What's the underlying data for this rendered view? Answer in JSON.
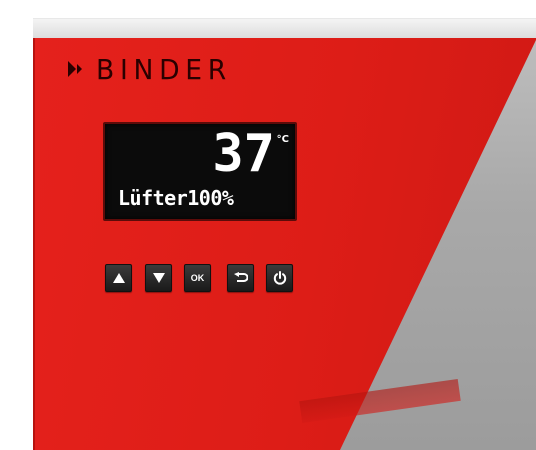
{
  "device": {
    "brand": "BINDER",
    "display": {
      "temperature": "37",
      "unit": "°C",
      "status": "Lüfter100%"
    },
    "buttons": [
      {
        "id": "up",
        "label": "",
        "icon": "triangle-up-icon"
      },
      {
        "id": "down",
        "label": "",
        "icon": "triangle-down-icon"
      },
      {
        "id": "ok",
        "label": "OK",
        "icon": ""
      },
      {
        "id": "back",
        "label": "",
        "icon": "return-arrow-icon"
      },
      {
        "id": "power",
        "label": "",
        "icon": "power-icon"
      }
    ]
  },
  "colors": {
    "panel": "#e01f1a",
    "display_bg": "#0b0b0b",
    "button_bg": "#2a2a2a",
    "text_light": "#ffffff"
  }
}
